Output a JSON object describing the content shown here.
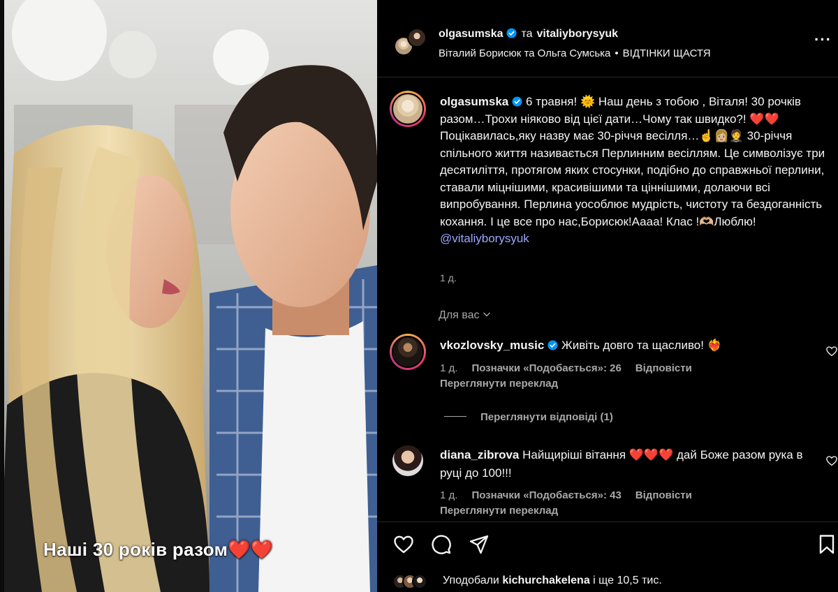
{
  "post": {
    "author": "olgasumska",
    "and_word": "та",
    "coauthor": "vitaliyborysyuk",
    "audio": "Віталий Борисюк та Ольга Сумська",
    "audio_sep": "•",
    "song": "ВІДТІНКИ ЩАСТЯ",
    "more_glyph": "···",
    "video_caption": "Наші 30 років разом❤️❤️"
  },
  "caption": {
    "username": "olgasumska",
    "text_1": "6 травня! 🌞 Наш день з тобою , Віталя! 30 рочків разом…Трохи ніяково від цієї дати…Чому так швидко?! ❤️❤️ Поцікавилась,яку назву має 30-річчя весілля…☝️👩🏼🤵 30-річчя спільного життя називається Перлинним весіллям. Це символізує три десятиліття, протягом яких стосунки, подібно до справжньої перлини, ставали міцнішими, красивішими та ціннішими, долаючи всі випробування. Перлина уособлює мудрість, чистоту та бездоганність кохання. І це все про нас,Борисюк!Аааа! Клас !🫶🏼Люблю! ",
    "mention": "@vitaliyborysyuk",
    "time": "1 д."
  },
  "for_you": "Для вас",
  "comments": [
    {
      "username": "vkozlovsky_music",
      "text": "Живіть довго та щасливо! ❤️‍🔥",
      "time": "1 д.",
      "likes": "Позначки «Подобається»: 26",
      "reply": "Відповісти",
      "translate": "Переглянути переклад",
      "view_replies": "Переглянути відповіді (1)"
    },
    {
      "username": "diana_zibrova",
      "text": "Найщиріші вітання ❤️❤️❤️ дай Боже разом рука в руці до 100!!!",
      "time": "1 д.",
      "likes": "Позначки «Подобається»: 43",
      "reply": "Відповісти",
      "translate": "Переглянути переклад"
    }
  ],
  "likes_line": {
    "prefix": "Уподобали",
    "user": "kichurchakelena",
    "suffix": "і ще 10,5 тис."
  },
  "colors": {
    "background": "#000000",
    "text": "#f5f5f5",
    "muted": "#a8a8a8",
    "mention": "#9ca8ff",
    "verified": "#0095f6"
  }
}
